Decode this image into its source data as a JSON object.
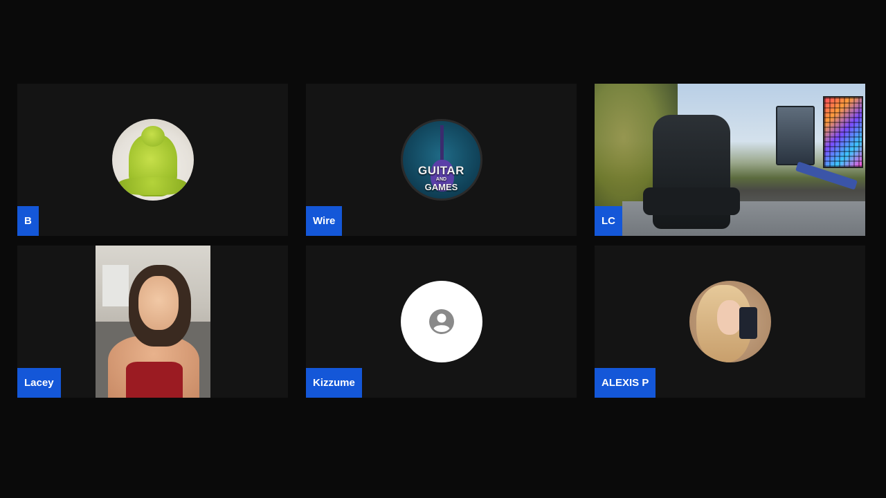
{
  "participants": [
    {
      "name": "B",
      "avatar": "shrek-avatar"
    },
    {
      "name": "Wire",
      "avatar": "guitar-and-games-logo",
      "logo_text": [
        "GUITAR",
        "AND",
        "GAMES"
      ]
    },
    {
      "name": "LC",
      "avatar": "camera-video-gaming-setup"
    },
    {
      "name": "Lacey",
      "avatar": "camera-video-person"
    },
    {
      "name": "Kizzume",
      "avatar": "default-user-icon"
    },
    {
      "name": "ALEXIS P",
      "avatar": "profile-photo"
    }
  ],
  "colors": {
    "background": "#0a0a0a",
    "tile": "#141414",
    "name_badge": "#1457d8",
    "badge_text": "#ffffff"
  }
}
